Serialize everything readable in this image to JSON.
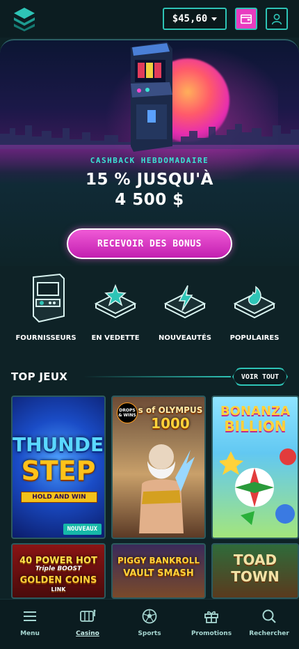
{
  "header": {
    "balance": "$45,60",
    "logo_icon": "layers-logo-icon",
    "wallet_icon": "wallet-icon",
    "profile_icon": "user-icon",
    "accent": "#2ec4b6",
    "wallet_color": "#e93cc0"
  },
  "hero": {
    "subtitle": "CASHBACK HEBDOMADAIRE",
    "title_line1": "15 % JUSQU'À",
    "title_line2": "4 500 $",
    "cta_label": "RECEVOIR DES BONUS",
    "cta_color": "#e93cc0"
  },
  "categories": [
    {
      "label": "FOURNISSEURS",
      "icon": "arcade-icon"
    },
    {
      "label": "EN VEDETTE",
      "icon": "star-badge-icon"
    },
    {
      "label": "NOUVEAUTÉS",
      "icon": "lightning-icon"
    },
    {
      "label": "POPULAIRES",
      "icon": "flame-icon"
    }
  ],
  "top_games": {
    "title": "TOP JEUX",
    "see_all": "VOIR TOUT",
    "games": [
      {
        "name_line1": "THUNDER",
        "name_line2": "STEP",
        "tagline": "HOLD AND WIN",
        "badge": "NOUVEAUX"
      },
      {
        "name_line1": "s of OLYMPUS",
        "name_line2": "1000",
        "drops_label": "DROPS & WINS"
      },
      {
        "name_line1": "BONANZA",
        "name_line2": "BILLION"
      },
      {
        "name_line1": "40 POWER HOT",
        "name_line2": "Triple BOOST",
        "name_line3": "GOLDEN COINS",
        "name_line4": "LINK"
      },
      {
        "name_line1": "PIGGY BANKROLL",
        "name_line2": "VAULT SMASH"
      },
      {
        "name_line1": "TOAD",
        "name_line2": "TOWN"
      }
    ]
  },
  "nav": [
    {
      "label": "Menu",
      "icon": "menu-icon"
    },
    {
      "label": "Casino",
      "icon": "slot-machine-icon",
      "active": true
    },
    {
      "label": "Sports",
      "icon": "soccer-ball-icon"
    },
    {
      "label": "Promotions",
      "icon": "gift-icon"
    },
    {
      "label": "Rechercher",
      "icon": "search-icon"
    }
  ]
}
